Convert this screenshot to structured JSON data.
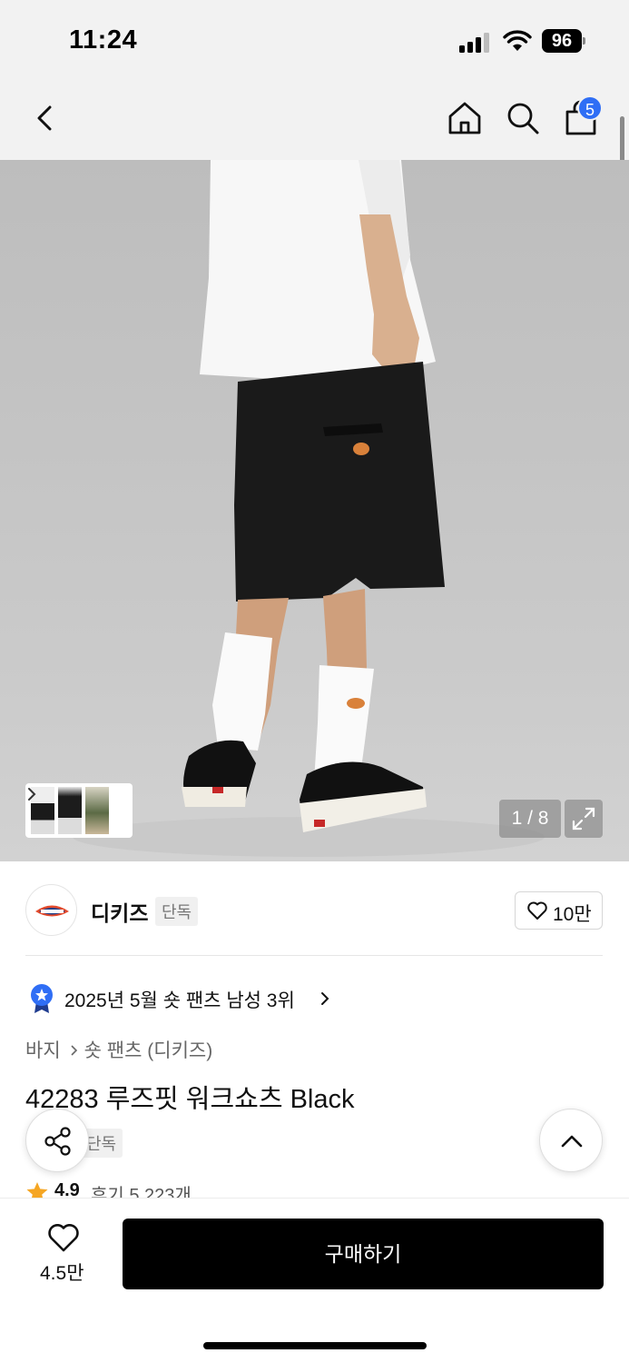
{
  "status_bar": {
    "time": "11:24",
    "battery": "96"
  },
  "nav": {
    "cart_count": "5"
  },
  "gallery": {
    "counter": "1 / 8"
  },
  "brand": {
    "name": "디키즈",
    "tag": "단독",
    "like_count": "10만"
  },
  "ranking": {
    "text": "2025년 5월 숏 팬츠 남성 3위"
  },
  "breadcrumb": {
    "level1": "바지",
    "level2": "숏 팬츠 (디키즈)"
  },
  "product": {
    "title": "42283 루즈핏 워크쇼츠 Black",
    "exclusive_tag": "단독",
    "rating": "4.9",
    "review_label": "후기 5,223개"
  },
  "bottom_bar": {
    "wish_count": "4.5만",
    "buy_label": "구매하기"
  },
  "colors": {
    "accent_blue": "#2f6ef5",
    "buy_button": "#000000",
    "star": "#f5a623"
  },
  "icons": [
    "back-icon",
    "home-icon",
    "search-icon",
    "cart-icon",
    "heart-icon",
    "share-icon",
    "chevron-up-icon",
    "expand-icon",
    "star-icon",
    "rank-badge-icon"
  ]
}
